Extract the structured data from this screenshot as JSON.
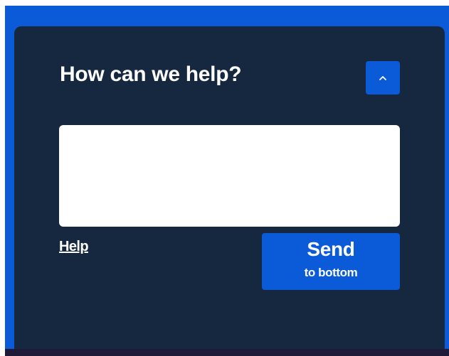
{
  "widget": {
    "title": "How can we help?",
    "collapse_icon": "chevron-up-icon",
    "message": {
      "value": "",
      "placeholder": ""
    },
    "help_link_label": "Help",
    "send_button": {
      "label": "Send",
      "sublabel": "to bottom"
    }
  },
  "colors": {
    "frame": "#0b5bd8",
    "panel": "#162840",
    "accent": "#0b5bd8",
    "text": "#ffffff",
    "input_background": "#ffffff"
  }
}
